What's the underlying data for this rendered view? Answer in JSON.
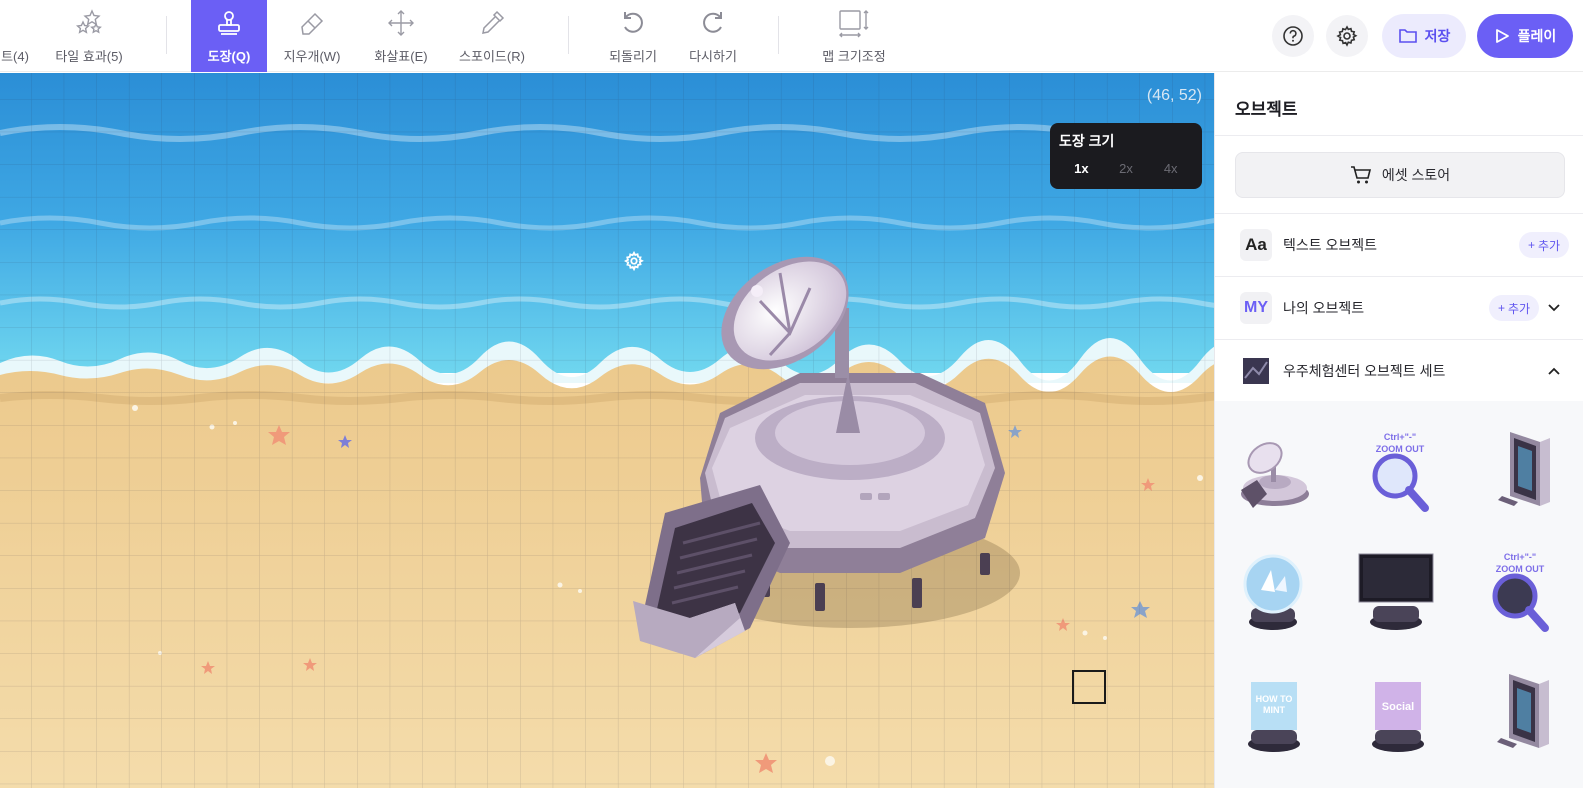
{
  "toolbar": {
    "tools": [
      {
        "label": "트(4)",
        "icon": "tile-icon"
      },
      {
        "label": "타일 효과(5)",
        "icon": "stars-icon"
      },
      {
        "label": "도장(Q)",
        "icon": "stamp-icon",
        "active": true
      },
      {
        "label": "지우개(W)",
        "icon": "eraser-icon"
      },
      {
        "label": "화살표(E)",
        "icon": "move-arrows-icon"
      },
      {
        "label": "스포이드(R)",
        "icon": "eyedropper-icon"
      },
      {
        "label": "되돌리기",
        "icon": "undo-icon"
      },
      {
        "label": "다시하기",
        "icon": "redo-icon"
      },
      {
        "label": "맵 크기조정",
        "icon": "resize-map-icon"
      }
    ],
    "help_icon": "help-icon",
    "settings_icon": "gear-icon",
    "save_label": "저장",
    "play_label": "플레이",
    "accent": "#6b5ff5"
  },
  "canvas": {
    "coordinates": "(46, 52)",
    "brush_size": {
      "title": "도장 크기",
      "options": [
        "1x",
        "2x",
        "4x"
      ],
      "selected": "1x"
    }
  },
  "panel": {
    "title": "오브젝트",
    "store_label": "에셋 스토어",
    "rows": [
      {
        "badge": "Aa",
        "label": "텍스트 오브젝트",
        "add_label": "추가"
      },
      {
        "badge": "MY",
        "label": "나의 오브젝트",
        "add_label": "추가"
      },
      {
        "label": "우주체험센터 오브젝트 세트"
      }
    ],
    "objects": [
      {
        "name": "radar-station"
      },
      {
        "name": "zoom-out-sign",
        "text": "Ctrl+\"-\"\nZOOM OUT"
      },
      {
        "name": "gate-door"
      },
      {
        "name": "crystal-ball"
      },
      {
        "name": "monitor-screen"
      },
      {
        "name": "zoom-out-sign-dark",
        "text": "Ctrl+\"-\"\nZOOM OUT"
      },
      {
        "name": "how-to-mint-sign",
        "text": "HOW TO\nMINT"
      },
      {
        "name": "social-sign",
        "text": "Social"
      },
      {
        "name": "gate-door-2"
      }
    ]
  }
}
